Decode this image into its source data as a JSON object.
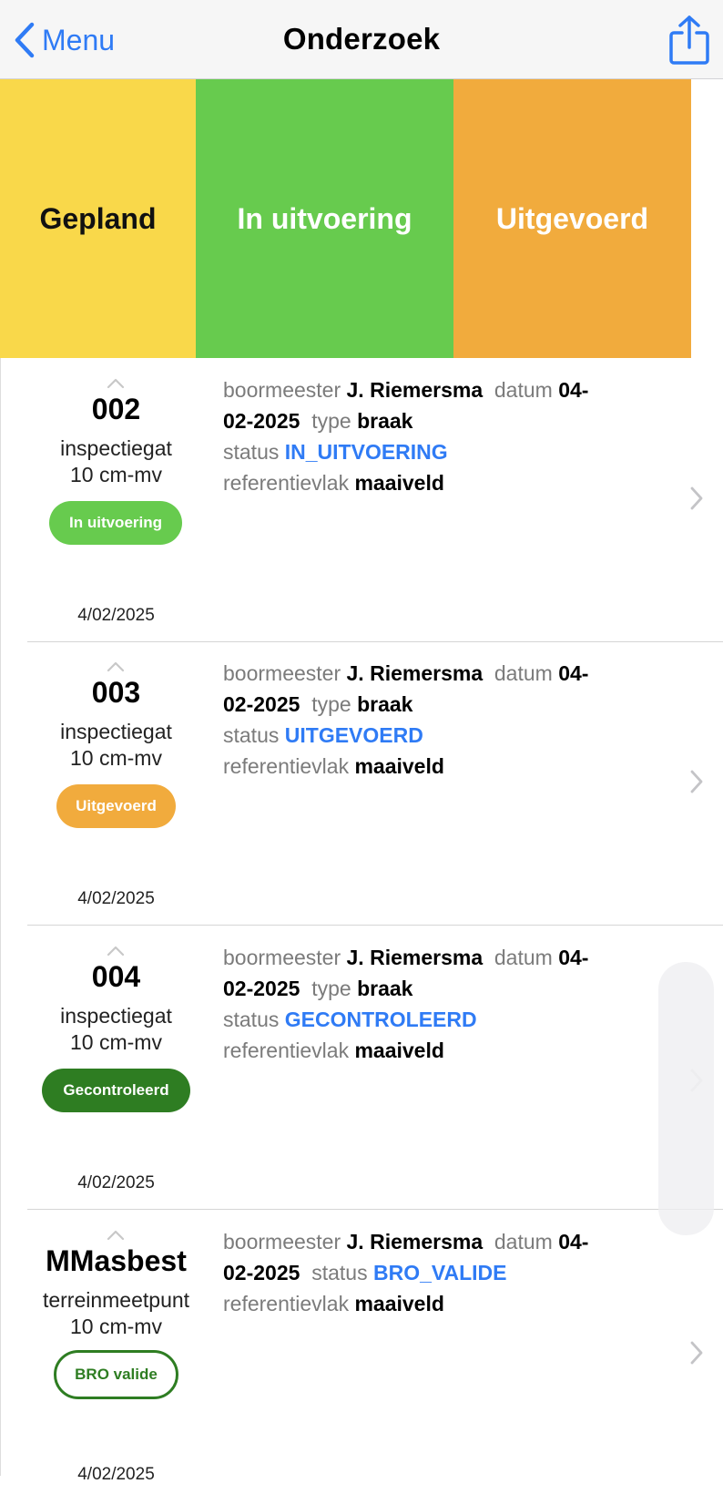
{
  "nav": {
    "back_label": "Menu",
    "title": "Onderzoek"
  },
  "tabs": [
    {
      "label": "Gepland",
      "color": "#f9d84a"
    },
    {
      "label": "In uitvoering",
      "color": "#67cb4e"
    },
    {
      "label": "Uitgevoerd",
      "color": "#f1ab3d"
    }
  ],
  "colors": {
    "accent": "#2f7bf5",
    "badge_in_uitvoering": "#67cb4e",
    "badge_uitgevoerd": "#f1ab3d",
    "badge_gecontroleerd": "#2e7d22",
    "badge_bro_valide": "#2e7d22"
  },
  "labels": {
    "boormeester": "boormeester",
    "datum": "datum",
    "type": "type",
    "status": "status",
    "referentievlak": "referentievlak"
  },
  "rows": [
    {
      "code": "002",
      "kind": "inspectiegat",
      "depth": "10 cm-mv",
      "badge": "In uitvoering",
      "date": "4/02/2025",
      "boormeester": "J. Riemersma",
      "datum_a": "04-",
      "datum_b": "02-2025",
      "type": "braak",
      "status": "IN_UITVOERING",
      "referentievlak": "maaiveld"
    },
    {
      "code": "003",
      "kind": "inspectiegat",
      "depth": "10 cm-mv",
      "badge": "Uitgevoerd",
      "date": "4/02/2025",
      "boormeester": "J. Riemersma",
      "datum_a": "04-",
      "datum_b": "02-2025",
      "type": "braak",
      "status": "UITGEVOERD",
      "referentievlak": "maaiveld"
    },
    {
      "code": "004",
      "kind": "inspectiegat",
      "depth": "10 cm-mv",
      "badge": "Gecontroleerd",
      "date": "4/02/2025",
      "boormeester": "J. Riemersma",
      "datum_a": "04-",
      "datum_b": "02-2025",
      "type": "braak",
      "status": "GECONTROLEERD",
      "referentievlak": "maaiveld"
    },
    {
      "code": "MMasbest",
      "kind": "terreinmeetpunt",
      "depth": "10 cm-mv",
      "badge": "BRO valide",
      "date": "4/02/2025",
      "boormeester": "J. Riemersma",
      "datum_a": "04-",
      "datum_b": "02-2025",
      "status": "BRO_VALIDE",
      "referentievlak": "maaiveld"
    }
  ]
}
